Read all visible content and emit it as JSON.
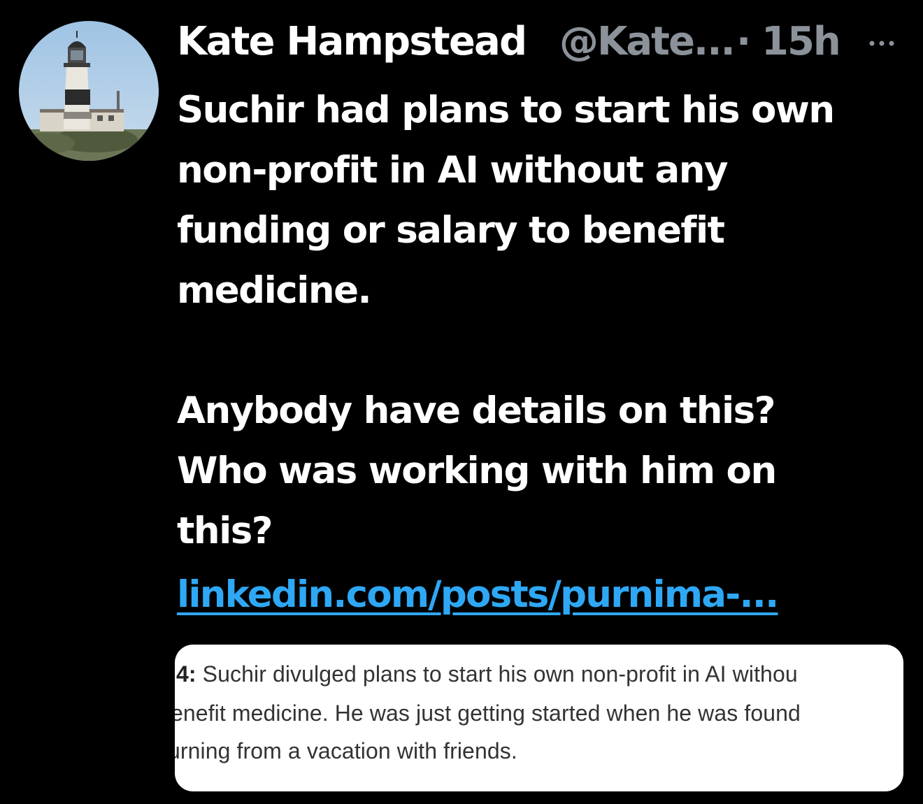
{
  "tweet": {
    "author_name": "Kate Hampstead",
    "author_handle": "@Kate...",
    "separator": "·",
    "time": "15h",
    "more_label": "···",
    "body_line_1": "Suchir had plans to start his own",
    "body_line_2": "non-profit in AI without any",
    "body_line_3": "funding or salary to benefit",
    "body_line_4": "medicine.",
    "body_line_5": "Anybody have details on this?",
    "body_line_6": "Who was working with him on",
    "body_line_7": "this?",
    "link_text": "linkedin.com/posts/purnima-..."
  },
  "card": {
    "line_1_prefix": "4:",
    "line_1_text": " Suchir divulged plans to start his own non-profit in AI withou",
    "line_2_text": "enefit medicine. He was just getting started when he was found",
    "line_3_text": "urning from a vacation with friends."
  },
  "colors": {
    "background": "#000000",
    "text": "#ffffff",
    "secondary": "#8b9299",
    "link": "#2ea8f5"
  }
}
